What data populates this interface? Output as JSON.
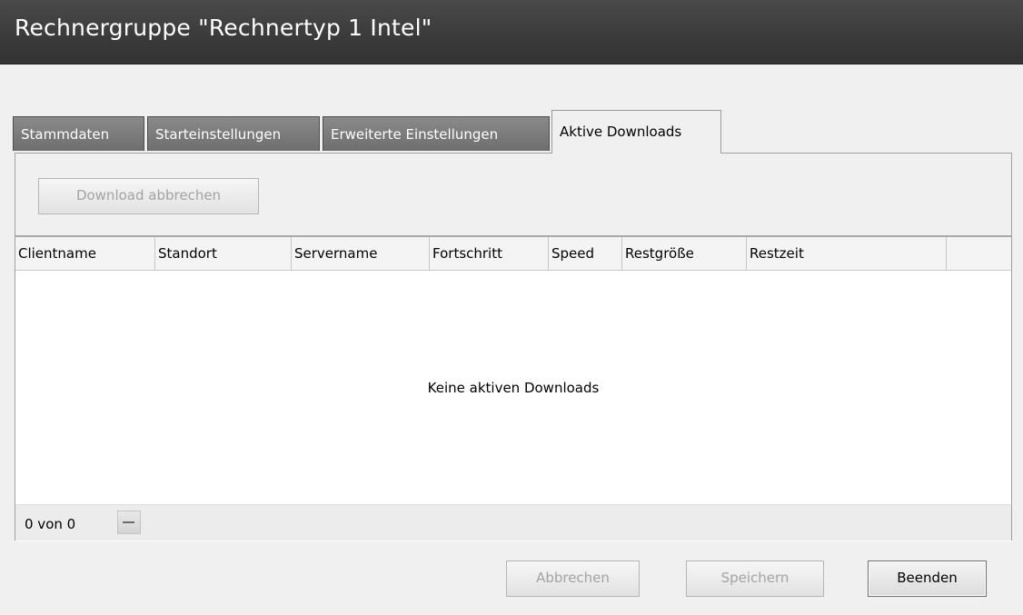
{
  "window": {
    "title": "Rechnergruppe \"Rechnertyp 1 Intel\""
  },
  "tabs": [
    {
      "label": "Stammdaten",
      "active": false
    },
    {
      "label": "Starteinstellungen",
      "active": false
    },
    {
      "label": "Erweiterte Einstellungen",
      "active": false
    },
    {
      "label": "Aktive Downloads",
      "active": true
    }
  ],
  "toolbar": {
    "cancel_download_label": "Download abbrechen",
    "cancel_download_enabled": false
  },
  "table": {
    "columns": [
      "Clientname",
      "Standort",
      "Servername",
      "Fortschritt",
      "Speed",
      "Restgröße",
      "Restzeit"
    ],
    "rows": [],
    "empty_message": "Keine aktiven Downloads",
    "pager_text": "0 von 0"
  },
  "footer": {
    "abbrechen_label": "Abbrechen",
    "speichern_label": "Speichern",
    "beenden_label": "Beenden"
  }
}
